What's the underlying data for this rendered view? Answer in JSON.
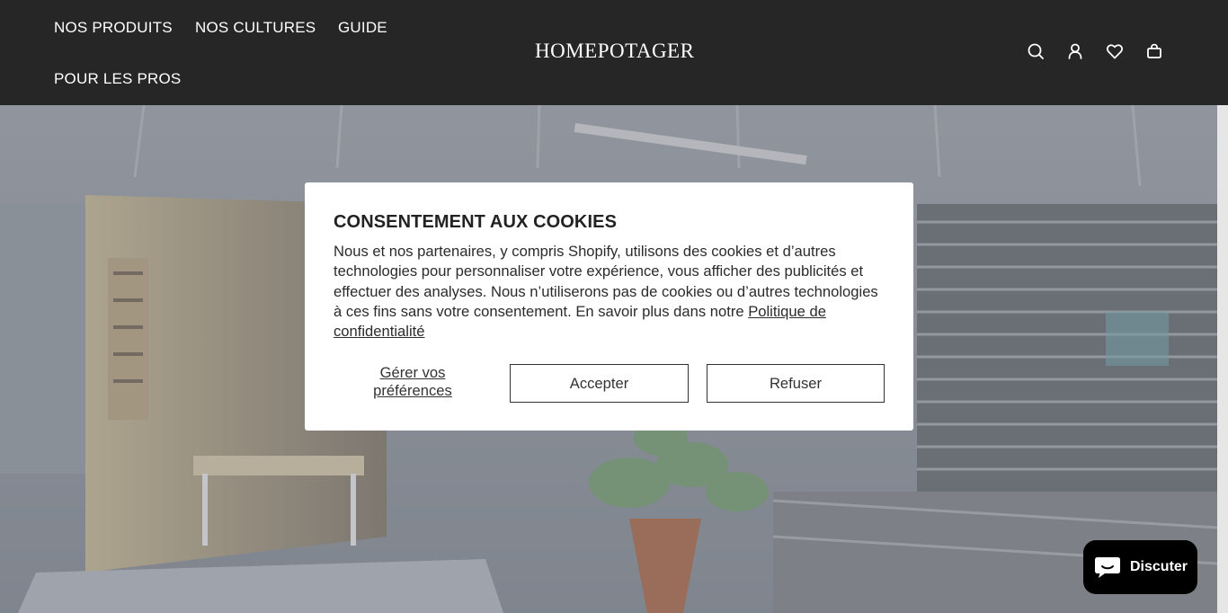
{
  "header": {
    "nav": [
      {
        "label": "NOS PRODUITS"
      },
      {
        "label": "NOS CULTURES"
      },
      {
        "label": "GUIDE"
      },
      {
        "label": "POUR LES PROS"
      }
    ],
    "logo": "HOMEPOTAGER",
    "icons": [
      "search-icon",
      "account-icon",
      "wishlist-icon",
      "cart-icon"
    ]
  },
  "cookie_modal": {
    "title": "CONSENTEMENT AUX COOKIES",
    "body": "Nous et nos partenaires, y compris Shopify, utilisons des cookies et d’autres technologies pour personnaliser votre expérience, vous afficher des publicités et effectuer des analyses. Nous n’utiliserons pas de cookies ou d’autres technologies à ces fins sans votre consentement. En savoir plus dans notre",
    "policy_link": "Politique de confidentialité",
    "manage_label": "Gérer vos préférences",
    "accept_label": "Accepter",
    "refuse_label": "Refuser"
  },
  "chat": {
    "label": "Discuter",
    "icon": "chat-bubble-icon"
  },
  "colors": {
    "header_bg": "#262626",
    "modal_bg": "#ffffff",
    "chat_bg": "#000000"
  }
}
